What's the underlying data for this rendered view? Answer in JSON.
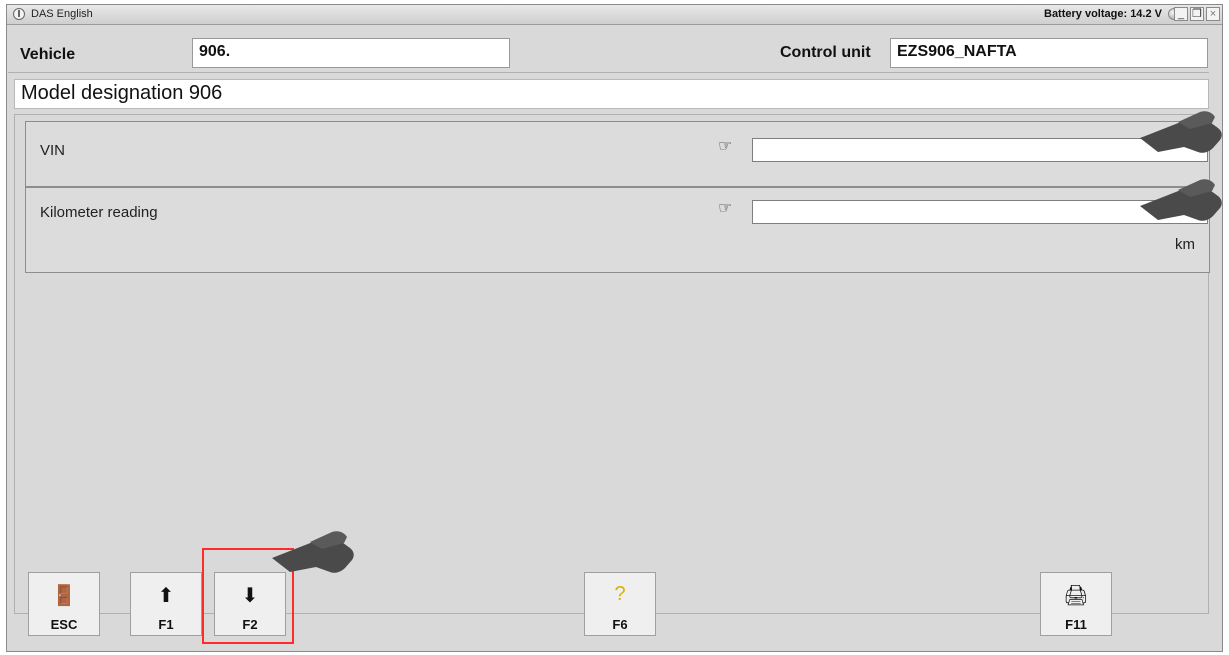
{
  "window": {
    "title": "DAS English",
    "battery_text": "Battery voltage: 14.2 V",
    "controls": {
      "minimize": "_",
      "restore": "❐",
      "close": "×"
    }
  },
  "header": {
    "vehicle_label": "Vehicle",
    "vehicle_value": "906.",
    "control_unit_label": "Control unit",
    "control_unit_value": "EZS906_NAFTA"
  },
  "model": {
    "designation": "Model designation 906"
  },
  "fields": [
    {
      "label": "VIN",
      "value": ""
    },
    {
      "label": "Kilometer reading",
      "value": "",
      "unit": "km"
    }
  ],
  "toolbar": {
    "esc_label": "ESC",
    "f1_label": "F1",
    "f2_label": "F2",
    "f6_label": "F6",
    "f11_label": "F11"
  },
  "colors": {
    "highlight": "#ff2a2a",
    "panel_bg": "#d9d9d9"
  }
}
